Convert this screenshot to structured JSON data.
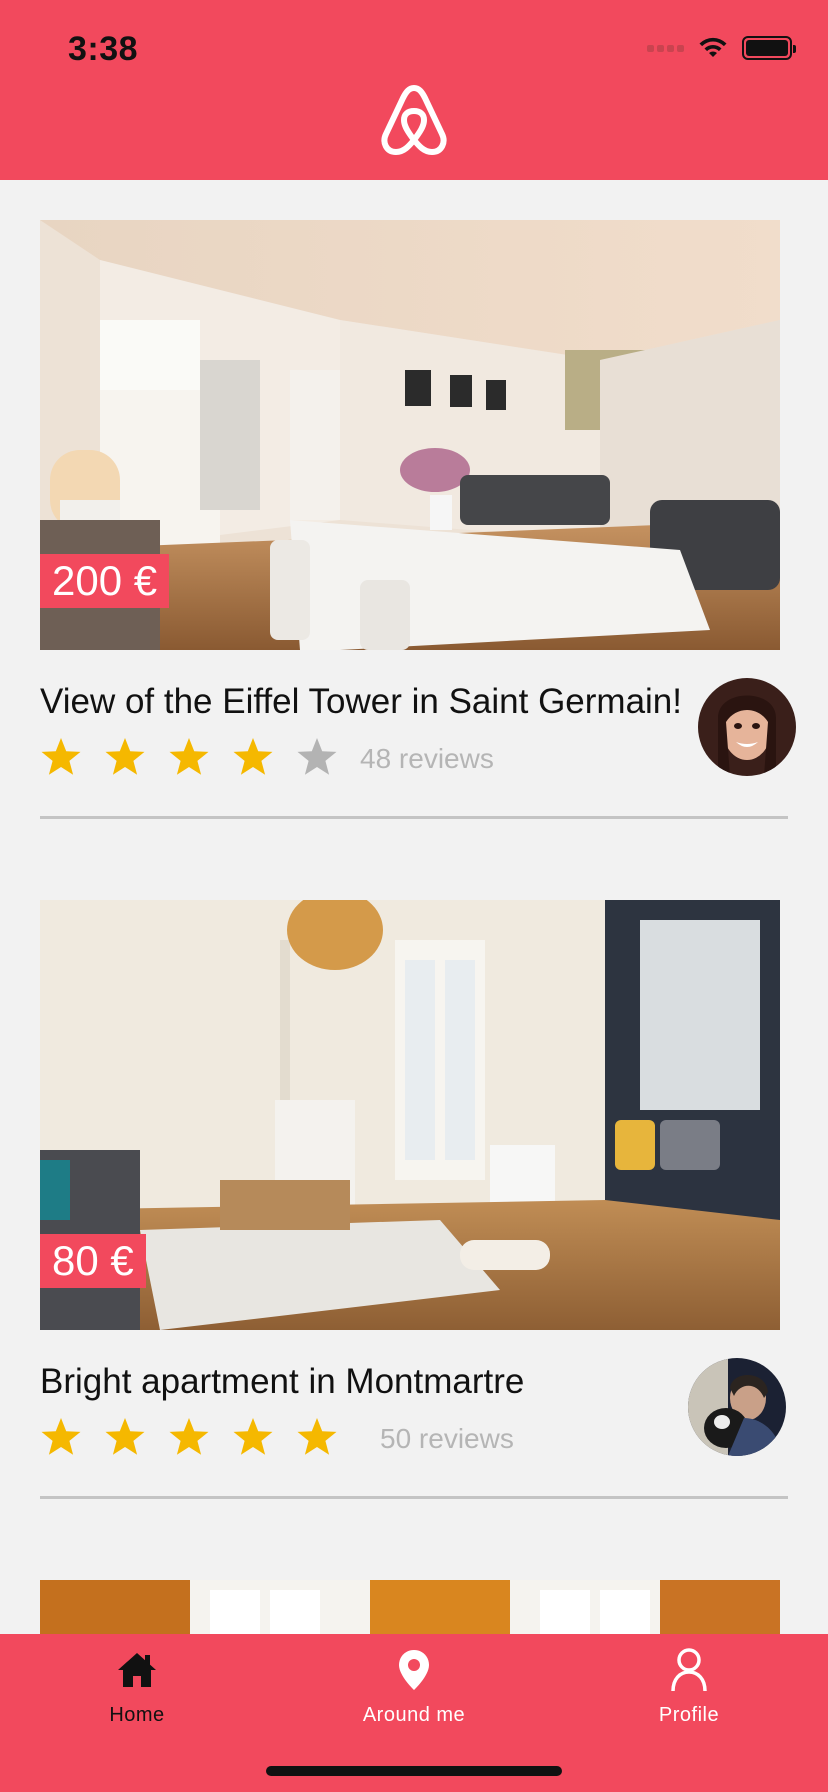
{
  "status_bar": {
    "time": "3:38"
  },
  "header": {
    "logo_icon": "airbnb-belo-logo",
    "brand_color": "#F2495D"
  },
  "listings": [
    {
      "price": "200 €",
      "title": "View of the Eiffel Tower in Saint Germain!",
      "rating": 4,
      "rating_max": 5,
      "reviews": "48 reviews",
      "host_avatar": "host-avatar"
    },
    {
      "price": "80 €",
      "title": "Bright apartment in Montmartre",
      "rating": 5,
      "rating_max": 5,
      "reviews": "50 reviews",
      "host_avatar": "host-avatar"
    }
  ],
  "tabbar": {
    "tabs": [
      {
        "label": "Home",
        "icon": "home-icon",
        "active": true
      },
      {
        "label": "Around me",
        "icon": "map-pin-icon",
        "active": false
      },
      {
        "label": "Profile",
        "icon": "user-icon",
        "active": false
      }
    ]
  },
  "colors": {
    "accent": "#F2495D",
    "star_on": "#F5B800",
    "star_off": "#B3B3B3",
    "tab_active": "#111111",
    "tab_inactive": "#FFFFFF"
  }
}
